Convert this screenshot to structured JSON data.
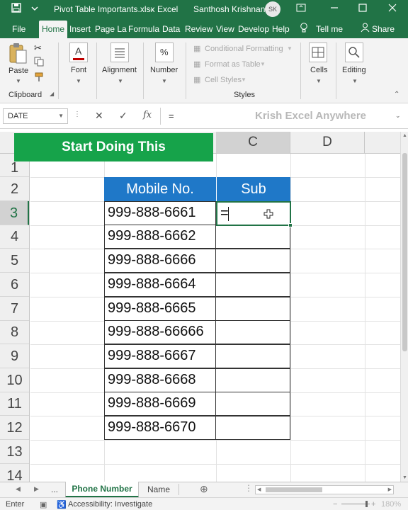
{
  "titlebar": {
    "filename": "Pivot Table Importants.xlsx",
    "separator": "-",
    "app": "Excel",
    "user": "Santhosh Krishnan",
    "initials": "SK"
  },
  "tabs": [
    "File",
    "Home",
    "Insert",
    "Page La",
    "Formula",
    "Data",
    "Review",
    "View",
    "Develop",
    "Help"
  ],
  "tell_me": "Tell me",
  "share": "Share",
  "ribbon": {
    "paste": "Paste",
    "clipboard": "Clipboard",
    "font": "Font",
    "alignment": "Alignment",
    "number": "Number",
    "conditional_formatting": "Conditional Formatting",
    "format_as_table": "Format as Table",
    "cell_styles": "Cell Styles",
    "styles": "Styles",
    "cells": "Cells",
    "editing": "Editing",
    "font_glyph": "A",
    "number_glyph": "%"
  },
  "formula_bar": {
    "name_box": "DATE",
    "cancel": "✕",
    "enter": "✓",
    "fx": "fx",
    "content": "=",
    "watermark": "Krish Excel Anywhere"
  },
  "banner": "Start Doing This",
  "columns": {
    "c": "C",
    "d": "D"
  },
  "row_numbers": [
    "1",
    "2",
    "3",
    "4",
    "5",
    "6",
    "7",
    "8",
    "9",
    "10",
    "11",
    "12",
    "13",
    "14"
  ],
  "table": {
    "header_b": "Mobile No.",
    "header_c": "Sub",
    "rows": [
      "999-888-6661",
      "999-888-6662",
      "999-888-6666",
      "999-888-6664",
      "999-888-6665",
      "999-888-66666",
      "999-888-6667",
      "999-888-6668",
      "999-888-6669",
      "999-888-6670"
    ]
  },
  "active_cell_value": "=",
  "sheets": {
    "more": "...",
    "active": "Phone Number",
    "other": "Name"
  },
  "status": {
    "mode": "Enter",
    "accessibility": "Accessibility: Investigate",
    "zoom": "180%"
  },
  "colors": {
    "excel_green": "#217346",
    "table_header": "#1f78c8",
    "banner_green": "#16a34a"
  }
}
